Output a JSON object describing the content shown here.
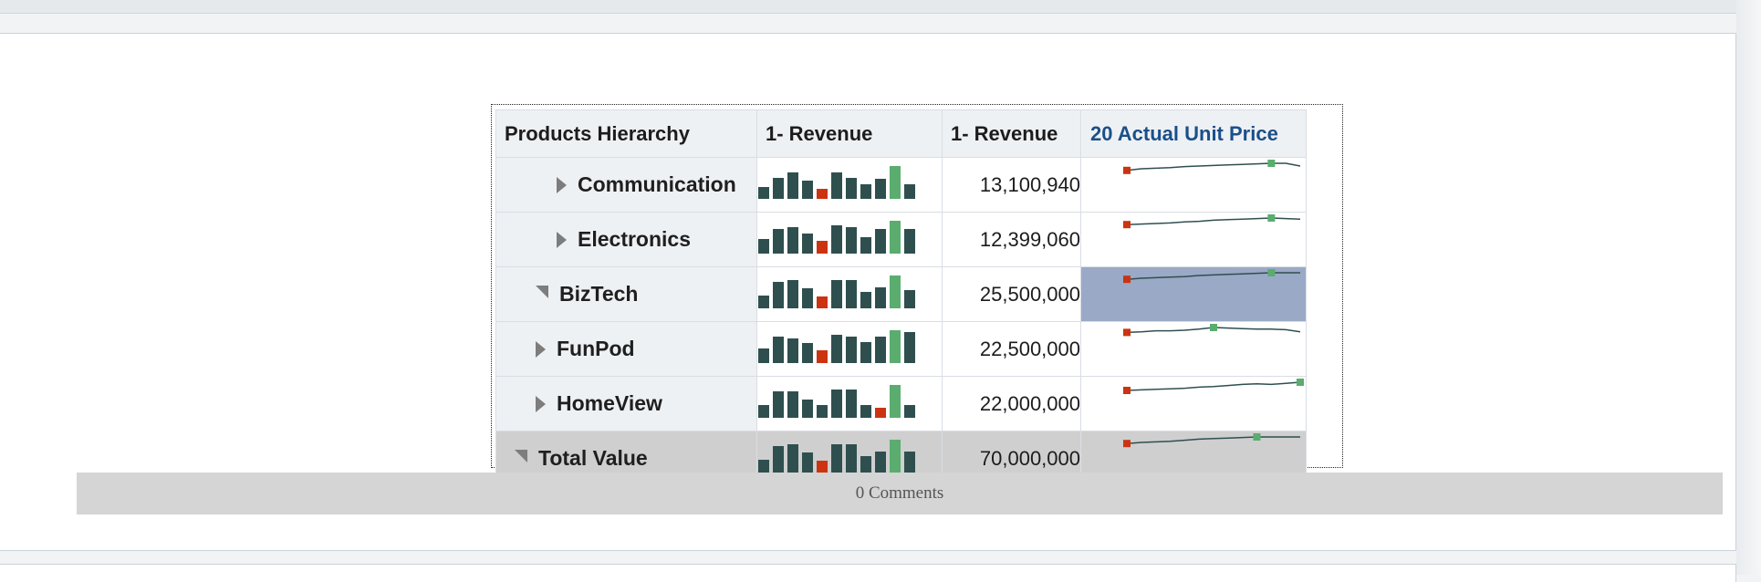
{
  "table": {
    "headers": [
      "Products Hierarchy",
      "1- Revenue",
      "1- Revenue",
      "20 Actual Unit Price"
    ],
    "rows": [
      {
        "label": "Communication",
        "indent": 2,
        "expander": "collapsed",
        "revenue": "13,100,940",
        "bars": [
          0.35,
          0.65,
          0.8,
          0.55,
          0.3,
          0.8,
          0.65,
          0.45,
          0.6,
          1.0,
          0.45
        ],
        "price_trend": [
          0.35,
          0.5,
          0.55,
          0.6,
          0.7,
          0.75,
          0.8,
          0.85,
          0.9,
          0.95,
          1.0,
          1.0,
          0.75
        ]
      },
      {
        "label": "Electronics",
        "indent": 2,
        "expander": "collapsed",
        "revenue": "12,399,060",
        "bars": [
          0.45,
          0.75,
          0.8,
          0.6,
          0.4,
          0.85,
          0.8,
          0.5,
          0.75,
          1.0,
          0.75
        ],
        "price_trend": [
          0.4,
          0.45,
          0.5,
          0.55,
          0.65,
          0.7,
          0.8,
          0.85,
          0.9,
          0.95,
          1.0,
          0.95,
          0.9
        ]
      },
      {
        "label": "BizTech",
        "indent": 1,
        "expander": "expanded",
        "revenue": "25,500,000",
        "bars": [
          0.4,
          0.8,
          0.85,
          0.6,
          0.35,
          0.85,
          0.85,
          0.5,
          0.65,
          1.0,
          0.55
        ],
        "price_trend": [
          0.4,
          0.5,
          0.55,
          0.6,
          0.65,
          0.75,
          0.8,
          0.85,
          0.9,
          0.95,
          1.0,
          1.0,
          1.0
        ]
      },
      {
        "label": "FunPod",
        "indent": 1,
        "expander": "collapsed",
        "revenue": "22,500,000",
        "bars": [
          0.45,
          0.8,
          0.75,
          0.6,
          0.4,
          0.85,
          0.8,
          0.65,
          0.8,
          1.0,
          0.95
        ],
        "price_trend": [
          0.55,
          0.6,
          0.7,
          0.7,
          0.75,
          0.85,
          1.0,
          0.95,
          0.9,
          0.85,
          0.85,
          0.8,
          0.6
        ]
      },
      {
        "label": "HomeView",
        "indent": 1,
        "expander": "collapsed",
        "revenue": "22,000,000",
        "bars": [
          0.4,
          0.8,
          0.8,
          0.55,
          0.4,
          0.85,
          0.85,
          0.4,
          0.3,
          1.0,
          0.4
        ],
        "price_trend": [
          0.25,
          0.3,
          0.35,
          0.4,
          0.45,
          0.55,
          0.6,
          0.7,
          0.8,
          0.85,
          0.8,
          0.9,
          1.0
        ]
      },
      {
        "label": "Total Value",
        "indent": 0,
        "expander": "expanded",
        "revenue": "70,000,000",
        "bars": [
          0.4,
          0.8,
          0.85,
          0.6,
          0.35,
          0.85,
          0.85,
          0.5,
          0.65,
          1.0,
          0.65
        ],
        "price_trend": [
          0.4,
          0.5,
          0.55,
          0.6,
          0.7,
          0.8,
          0.85,
          0.9,
          0.95,
          1.0,
          1.0,
          1.0,
          1.0
        ]
      }
    ]
  },
  "comments_label": "0 Comments",
  "colors": {
    "bar": "#2f4f4f",
    "bar_low": "#cc3311",
    "bar_high": "#5aad6e",
    "spark_line": "#2f4f4f",
    "spark_start": "#cc3311",
    "spark_high": "#5aad6e",
    "selected_row": "#9aa9c6",
    "total_row": "#cfcfcf"
  }
}
